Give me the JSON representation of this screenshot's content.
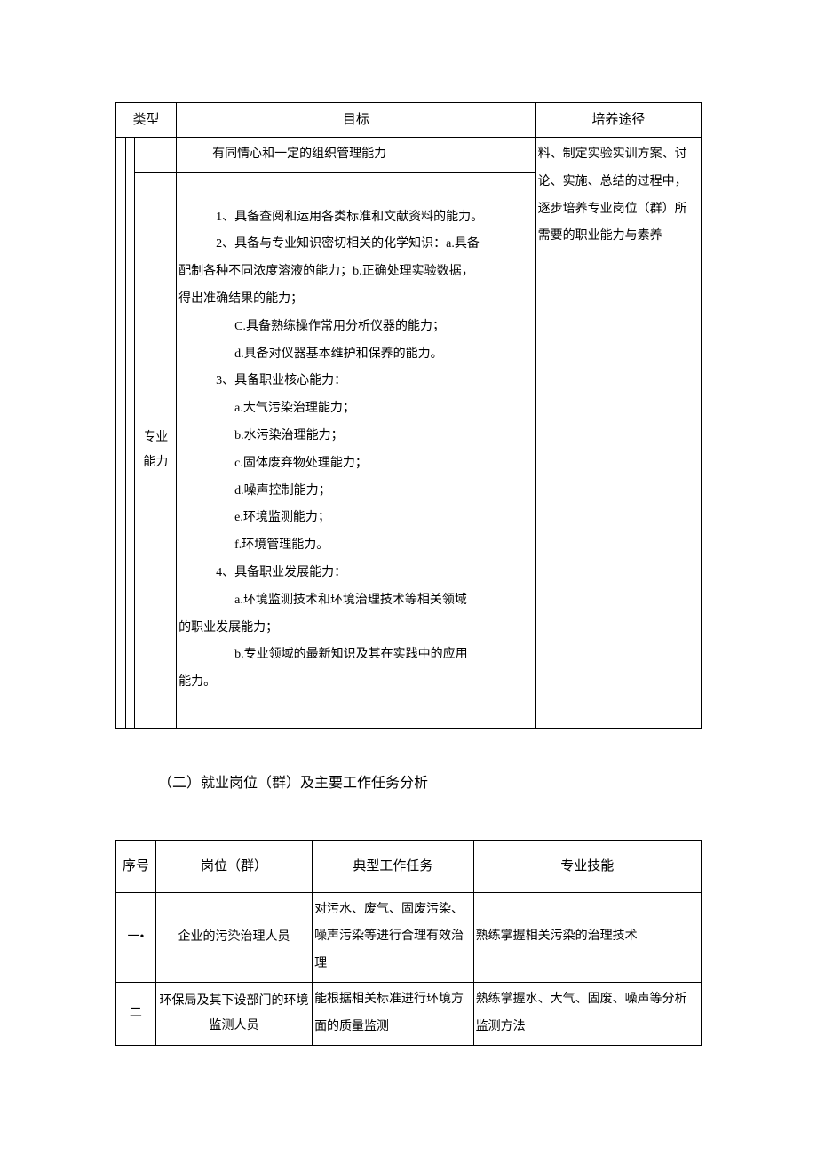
{
  "table1": {
    "headers": {
      "type": "类型",
      "target": "目标",
      "path": "培养途径"
    },
    "row1": {
      "target": "有同情心和一定的组织管理能力"
    },
    "row2": {
      "category": "专业能力",
      "lines": {
        "l1": "1、具备查阅和运用各类标准和文献资料的能力。",
        "l2": "2、具备与专业知识密切相关的化学知识：a.具备",
        "l3": "配制各种不同浓度溶液的能力；b.正确处理实验数据，",
        "l4": "得出准确结果的能力；",
        "l5": "C.具备熟练操作常用分析仪器的能力；",
        "l6": "d.具备对仪器基本维护和保养的能力。",
        "l7": "3、具备职业核心能力：",
        "l8": "a.大气污染治理能力；",
        "l9": "b.水污染治理能力；",
        "l10": "c.固体废弃物处理能力；",
        "l11": "d.噪声控制能力；",
        "l12": "e.环境监测能力；",
        "l13": "f.环境管理能力。",
        "l14": "4、具备职业发展能力：",
        "l15": "a.环境监测技术和环境治理技术等相关领域",
        "l16": "的职业发展能力；",
        "l17": "b.专业领域的最新知识及其在实践中的应用",
        "l18": "能力。"
      }
    },
    "path_col": {
      "p1": "料、制定实验实训方案、讨论、实施、总结的过程中，逐步培养专业岗位（群）所需要的职业能力与素养"
    }
  },
  "section_title": "（二）就业岗位（群）及主要工作任务分析",
  "table2": {
    "headers": {
      "no": "序号",
      "position": "岗位（群）",
      "task": "典型工作任务",
      "skill": "专业技能"
    },
    "rows": [
      {
        "no": "一•",
        "position": "企业的污染治理人员",
        "task": "对污水、废气、固废污染、噪声污染等进行合理有效治理",
        "skill": "熟练掌握相关污染的治理技术"
      },
      {
        "no": "二",
        "position": "环保局及其下设部门的环境监测人员",
        "task": "能根据相关标准进行环境方面的质量监测",
        "skill": "熟练掌握水、大气、固废、噪声等分析监测方法"
      }
    ]
  }
}
